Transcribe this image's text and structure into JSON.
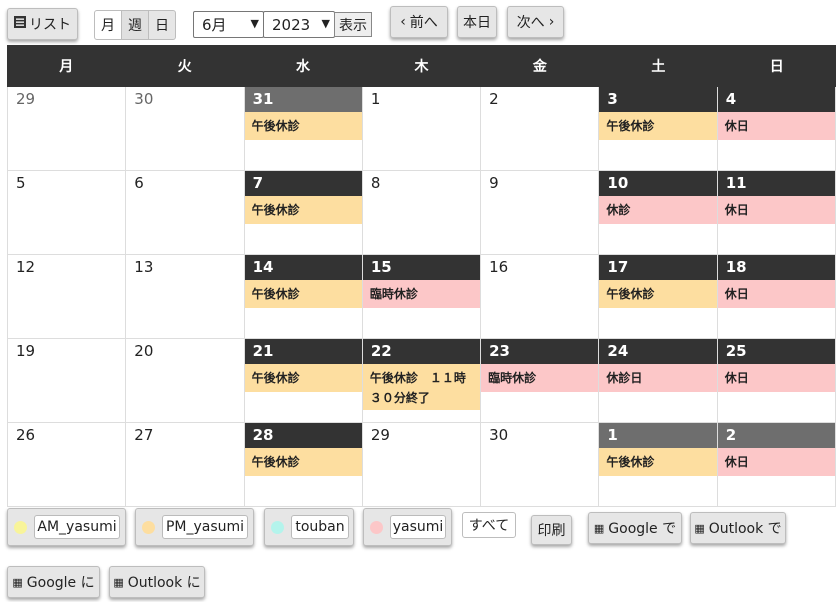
{
  "toolbar": {
    "list_label": "リスト",
    "view_month": "月",
    "view_week": "週",
    "view_day": "日",
    "month_value": "6月",
    "year_value": "2023",
    "show_label": "表示",
    "prev_label": "前へ",
    "today_label": "本日",
    "next_label": "次へ"
  },
  "weekdays": [
    "月",
    "火",
    "水",
    "木",
    "金",
    "土",
    "日"
  ],
  "weeks": [
    [
      {
        "day": "29",
        "style": "other",
        "events": []
      },
      {
        "day": "30",
        "style": "other",
        "events": []
      },
      {
        "day": "31",
        "style": "grey",
        "events": [
          {
            "text": "午後休診",
            "type": "pm"
          }
        ]
      },
      {
        "day": "1",
        "style": "plain",
        "events": []
      },
      {
        "day": "2",
        "style": "plain",
        "events": []
      },
      {
        "day": "3",
        "style": "dark",
        "events": [
          {
            "text": "午後休診",
            "type": "pm"
          }
        ]
      },
      {
        "day": "4",
        "style": "dark",
        "events": [
          {
            "text": "休日",
            "type": "ya"
          }
        ]
      }
    ],
    [
      {
        "day": "5",
        "style": "plain",
        "events": []
      },
      {
        "day": "6",
        "style": "plain",
        "events": []
      },
      {
        "day": "7",
        "style": "dark",
        "events": [
          {
            "text": "午後休診",
            "type": "pm"
          }
        ]
      },
      {
        "day": "8",
        "style": "plain",
        "events": []
      },
      {
        "day": "9",
        "style": "plain",
        "events": []
      },
      {
        "day": "10",
        "style": "dark",
        "events": [
          {
            "text": "休診",
            "type": "ya"
          }
        ]
      },
      {
        "day": "11",
        "style": "dark",
        "events": [
          {
            "text": "休日",
            "type": "ya"
          }
        ]
      }
    ],
    [
      {
        "day": "12",
        "style": "plain",
        "events": []
      },
      {
        "day": "13",
        "style": "plain",
        "events": []
      },
      {
        "day": "14",
        "style": "dark",
        "events": [
          {
            "text": "午後休診",
            "type": "pm"
          }
        ]
      },
      {
        "day": "15",
        "style": "dark",
        "events": [
          {
            "text": "臨時休診",
            "type": "ya"
          }
        ]
      },
      {
        "day": "16",
        "style": "plain",
        "events": []
      },
      {
        "day": "17",
        "style": "dark",
        "events": [
          {
            "text": "午後休診",
            "type": "pm"
          }
        ]
      },
      {
        "day": "18",
        "style": "dark",
        "events": [
          {
            "text": "休日",
            "type": "ya"
          }
        ]
      }
    ],
    [
      {
        "day": "19",
        "style": "plain",
        "events": []
      },
      {
        "day": "20",
        "style": "plain",
        "events": []
      },
      {
        "day": "21",
        "style": "dark",
        "events": [
          {
            "text": "午後休診",
            "type": "pm"
          }
        ]
      },
      {
        "day": "22",
        "style": "dark",
        "events": [
          {
            "text": "午後休診　１１時３０分終了",
            "type": "pm"
          }
        ]
      },
      {
        "day": "23",
        "style": "dark",
        "events": [
          {
            "text": "臨時休診",
            "type": "ya"
          }
        ]
      },
      {
        "day": "24",
        "style": "dark",
        "events": [
          {
            "text": "休診日",
            "type": "ya"
          }
        ]
      },
      {
        "day": "25",
        "style": "dark",
        "events": [
          {
            "text": "休日",
            "type": "ya"
          }
        ]
      }
    ],
    [
      {
        "day": "26",
        "style": "plain",
        "events": []
      },
      {
        "day": "27",
        "style": "plain",
        "events": []
      },
      {
        "day": "28",
        "style": "dark",
        "events": [
          {
            "text": "午後休診",
            "type": "pm"
          }
        ]
      },
      {
        "day": "29",
        "style": "plain",
        "events": []
      },
      {
        "day": "30",
        "style": "plain",
        "events": []
      },
      {
        "day": "1",
        "style": "grey",
        "events": [
          {
            "text": "午後休診",
            "type": "pm"
          }
        ]
      },
      {
        "day": "2",
        "style": "grey",
        "events": [
          {
            "text": "休日",
            "type": "ya"
          }
        ]
      }
    ]
  ],
  "legend": [
    {
      "label": "AM_yasumi",
      "color": "#f8f49a"
    },
    {
      "label": "PM_yasumi",
      "color": "#fddea0"
    },
    {
      "label": "touban",
      "color": "#b4f4ec"
    },
    {
      "label": "yasumi",
      "color": "#fcc7c8"
    }
  ],
  "footer": {
    "all_label": "すべて",
    "print_label": "印刷",
    "google_from_label": "Google で",
    "outlook_from_label": "Outlook で",
    "google_to_label": "Google に",
    "outlook_to_label": "Outlook に"
  },
  "colors": {
    "pm": "#fddea0",
    "yasumi": "#fcc7c8",
    "header": "#333333"
  }
}
